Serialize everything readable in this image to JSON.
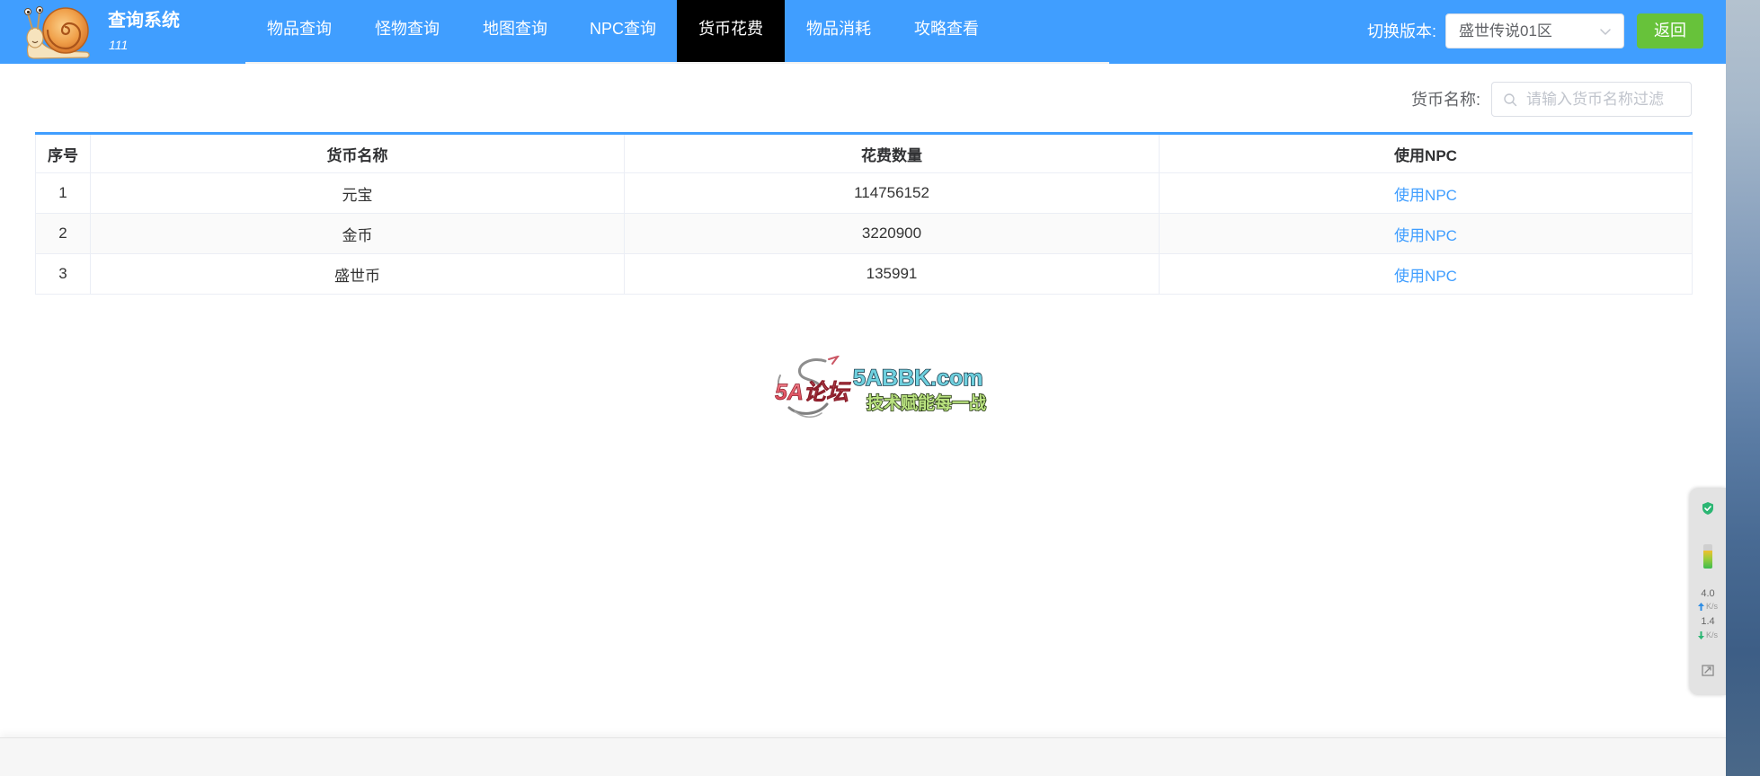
{
  "app": {
    "title": "查询系统",
    "subtitle": "111",
    "logo_icon": "snail-logo-icon"
  },
  "nav": {
    "items": [
      {
        "label": "物品查询",
        "active": false
      },
      {
        "label": "怪物查询",
        "active": false
      },
      {
        "label": "地图查询",
        "active": false
      },
      {
        "label": "NPC查询",
        "active": false
      },
      {
        "label": "货币花费",
        "active": true
      },
      {
        "label": "物品消耗",
        "active": false
      },
      {
        "label": "攻略查看",
        "active": false
      }
    ]
  },
  "version_switch": {
    "label": "切换版本:",
    "selected": "盛世传说01区",
    "icon": "chevron-down-icon"
  },
  "back_button": {
    "label": "返回"
  },
  "filter": {
    "label": "货币名称:",
    "placeholder": "请输入货币名称过滤",
    "value": "",
    "icon": "search-icon"
  },
  "table": {
    "columns": [
      "序号",
      "货币名称",
      "花费数量",
      "使用NPC"
    ],
    "rows": [
      {
        "index": "1",
        "name": "元宝",
        "amount": "114756152",
        "npc_link": "使用NPC"
      },
      {
        "index": "2",
        "name": "金币",
        "amount": "3220900",
        "npc_link": "使用NPC"
      },
      {
        "index": "3",
        "name": "盛世币",
        "amount": "135991",
        "npc_link": "使用NPC"
      }
    ]
  },
  "watermark": {
    "brand": "5A论坛",
    "site": "5ABBK.com",
    "slogan": "技术赋能每一战"
  },
  "net_widget": {
    "upload": "4.0",
    "upload_unit": "K/s",
    "download": "1.4",
    "download_unit": "K/s",
    "gauge_level": 0.75,
    "icons": [
      "shield-check-icon",
      "gauge-icon",
      "screenshot-icon"
    ]
  },
  "colors": {
    "header": "#409eff",
    "active_nav": "#000000",
    "back_button": "#67c23a",
    "link": "#409eff",
    "table_accent": "#409eff",
    "striped_row": "#fafafa"
  }
}
